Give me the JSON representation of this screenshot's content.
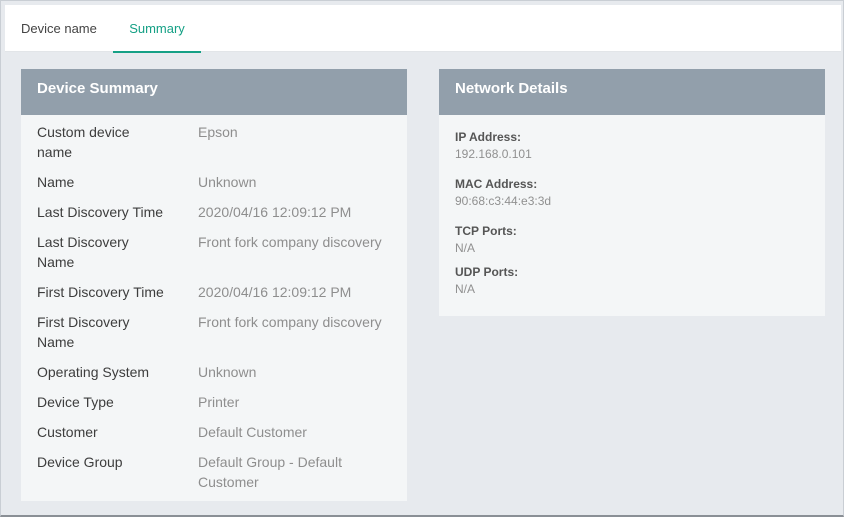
{
  "tabs": [
    {
      "label": "Device name",
      "active": false
    },
    {
      "label": "Summary",
      "active": true
    }
  ],
  "accent_color": "#15a085",
  "header_color": "#929fab",
  "device_summary": {
    "title": "Device Summary",
    "rows": [
      {
        "label": "Custom device name",
        "value": "Epson"
      },
      {
        "label": "Name",
        "value": "Unknown"
      },
      {
        "label": "Last Discovery Time",
        "value": "2020/04/16 12:09:12 PM"
      },
      {
        "label": "Last Discovery Name",
        "value": "Front fork company discovery"
      },
      {
        "label": "First Discovery Time",
        "value": "2020/04/16 12:09:12 PM"
      },
      {
        "label": "First Discovery Name",
        "value": "Front fork company discovery"
      },
      {
        "label": "Operating System",
        "value": "Unknown"
      },
      {
        "label": "Device Type",
        "value": "Printer"
      },
      {
        "label": "Customer",
        "value": "Default Customer"
      },
      {
        "label": "Device Group",
        "value": "Default Group - Default Customer"
      }
    ]
  },
  "network_details": {
    "title": "Network Details",
    "items": [
      {
        "label": "IP Address:",
        "value": "192.168.0.101"
      },
      {
        "label": "MAC Address:",
        "value": "90:68:c3:44:e3:3d"
      },
      {
        "label": "TCP Ports:",
        "value": "N/A"
      },
      {
        "label": "UDP Ports:",
        "value": "N/A"
      }
    ]
  }
}
